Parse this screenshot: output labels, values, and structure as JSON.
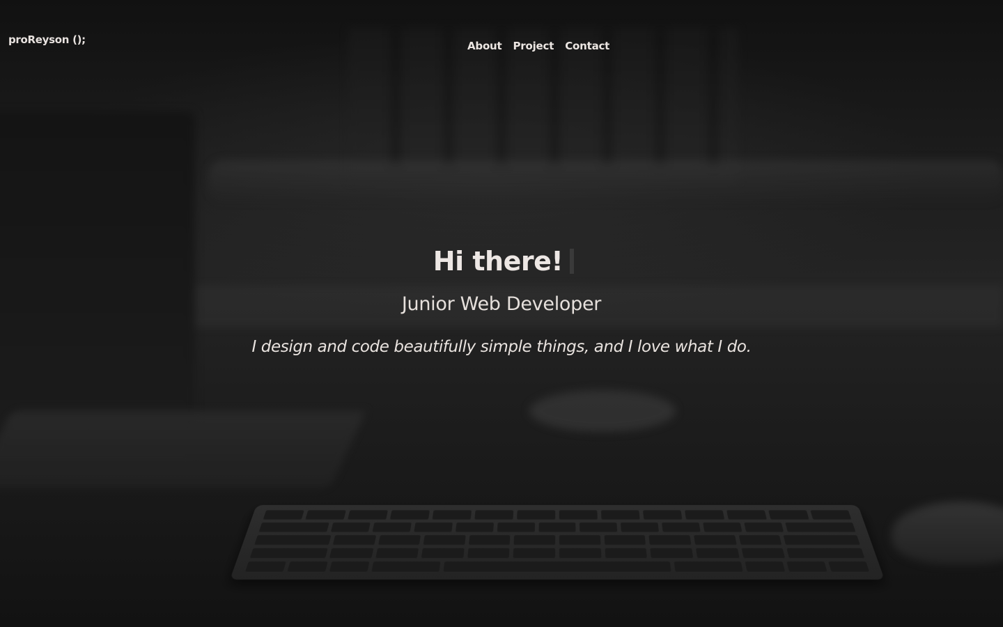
{
  "header": {
    "brand": "proReyson ();",
    "nav": [
      "About",
      "Project",
      "Contact"
    ]
  },
  "hero": {
    "title": "Hi there!",
    "subtitle": "Junior Web Developer",
    "tagline": "I design and code beautifully simple things, and I love what I do."
  },
  "colors": {
    "text": "#ede7e4",
    "background": "#1a1a1a",
    "cursor": "#3a3a3a"
  },
  "icons": {
    "typing_cursor": "text-cursor-icon"
  }
}
